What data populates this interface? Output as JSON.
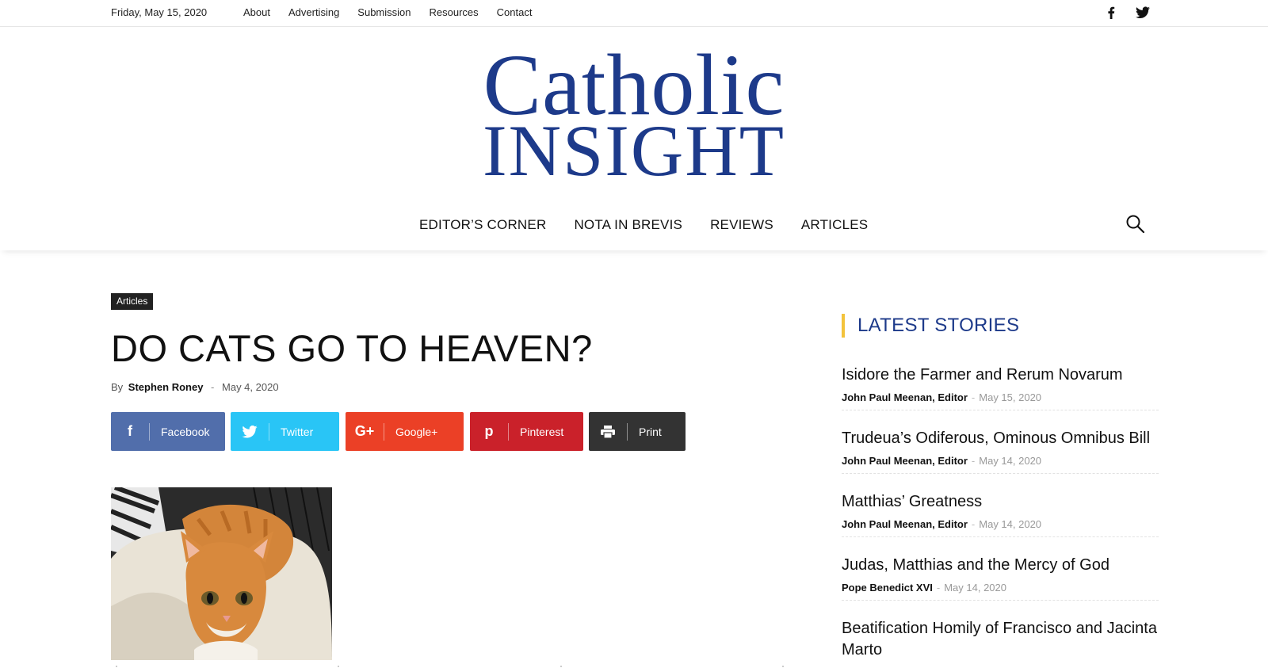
{
  "topbar": {
    "date": "Friday, May 15, 2020",
    "links": [
      "About",
      "Advertising",
      "Submission",
      "Resources",
      "Contact"
    ],
    "social_icons": [
      "facebook-icon",
      "twitter-icon"
    ]
  },
  "logo": {
    "line1": "Catholic",
    "line2": "INSIGHT",
    "color": "#1d3a8a"
  },
  "nav": {
    "items": [
      "EDITOR’S CORNER",
      "NOTA IN BREVIS",
      "REVIEWS",
      "ARTICLES"
    ],
    "search_icon": "search-icon"
  },
  "article": {
    "category": "Articles",
    "title": "DO CATS GO TO HEAVEN?",
    "by_label": "By",
    "author": "Stephen Roney",
    "date": "May 4, 2020",
    "separator": "-"
  },
  "share": {
    "facebook": {
      "label": "Facebook",
      "icon": "facebook-icon",
      "glyph": "f",
      "color": "#516eab"
    },
    "twitter": {
      "label": "Twitter",
      "icon": "twitter-icon",
      "color": "#29c5f6"
    },
    "google": {
      "label": "Google+",
      "icon": "google-plus-icon",
      "glyph": "G+",
      "color": "#eb4026"
    },
    "pinterest": {
      "label": "Pinterest",
      "icon": "pinterest-icon",
      "glyph": "p",
      "color": "#ca212a"
    },
    "print": {
      "label": "Print",
      "icon": "print-icon",
      "color": "#333333"
    }
  },
  "sidebar": {
    "title": "LATEST STORIES",
    "accent_color": "#f3c33c",
    "stories": [
      {
        "title": "Isidore the Farmer and Rerum Novarum",
        "author": "John Paul Meenan, Editor",
        "date": "May 15, 2020"
      },
      {
        "title": "Trudeua’s Odiferous, Ominous Omnibus Bill",
        "author": "John Paul Meenan, Editor",
        "date": "May 14, 2020"
      },
      {
        "title": "Matthias’ Greatness",
        "author": "John Paul Meenan, Editor",
        "date": "May 14, 2020"
      },
      {
        "title": "Judas, Matthias and the Mercy of God",
        "author": "Pope Benedict XVI",
        "date": "May 14, 2020"
      },
      {
        "title": "Beatification Homily of Francisco and Jacinta",
        "title_line2": "Marto"
      }
    ]
  }
}
